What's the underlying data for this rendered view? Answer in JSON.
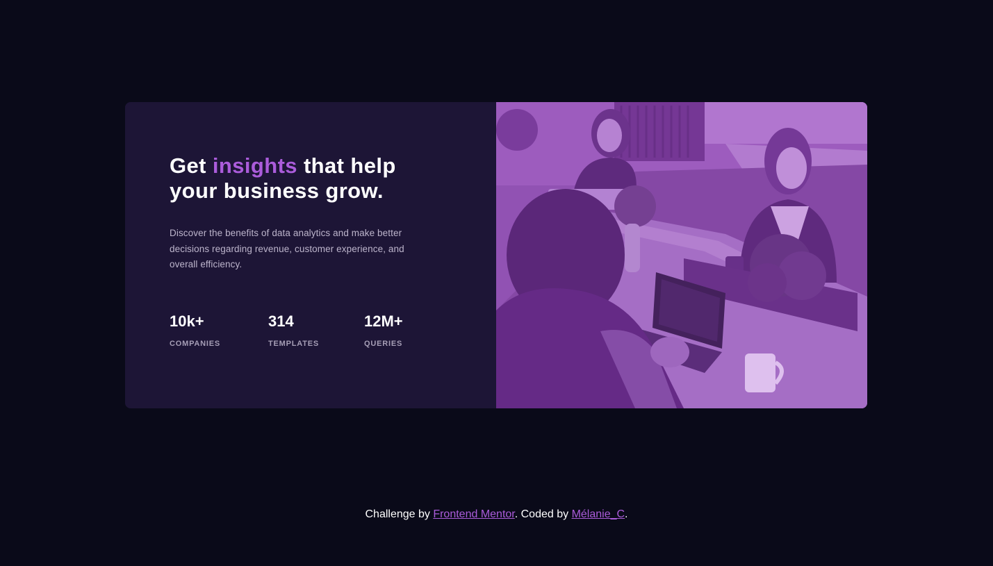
{
  "card": {
    "headline": {
      "before": "Get ",
      "accent": "insights",
      "after": " that help your business grow."
    },
    "description": "Discover the benefits of data analytics and make better decisions regarding revenue, customer experience, and overall efficiency.",
    "stats": [
      {
        "value": "10k+",
        "label": "COMPANIES"
      },
      {
        "value": "314",
        "label": "TEMPLATES"
      },
      {
        "value": "12M+",
        "label": "QUERIES"
      }
    ],
    "image": {
      "icon": "office-team-photo"
    }
  },
  "footer": {
    "prefix": "Challenge by ",
    "link1": "Frontend Mentor",
    "middle": ". Coded by ",
    "link2": "Mélanie_C",
    "suffix": "."
  },
  "colors": {
    "page_bg": "#0a0a19",
    "card_bg": "#1d1536",
    "accent": "#ab5cdb",
    "image_overlay": "#8b4ea8"
  }
}
